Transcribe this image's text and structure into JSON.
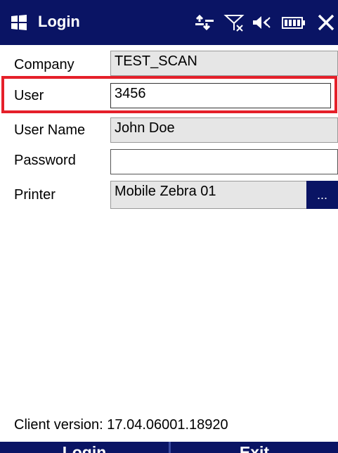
{
  "titlebar": {
    "title": "Login",
    "icons": [
      "windows-logo-icon",
      "connectivity-icon",
      "signal-off-icon",
      "volume-icon",
      "battery-icon",
      "close-icon"
    ]
  },
  "form": {
    "company": {
      "label": "Company",
      "value": "TEST_SCAN"
    },
    "user": {
      "label": "User",
      "value": "3456"
    },
    "user_name": {
      "label": "User Name",
      "value": "John Doe"
    },
    "password": {
      "label": "Password",
      "value": ""
    },
    "printer": {
      "label": "Printer",
      "value": "Mobile Zebra 01",
      "browse_label": "..."
    }
  },
  "footer": {
    "client_version": "Client version: 17.04.06001.18920"
  },
  "softkeys": {
    "left": "Login",
    "right": "Exit"
  },
  "colors": {
    "bar": "#0a1464",
    "highlight": "#e5202a",
    "readonly_field": "#e6e6e6"
  }
}
